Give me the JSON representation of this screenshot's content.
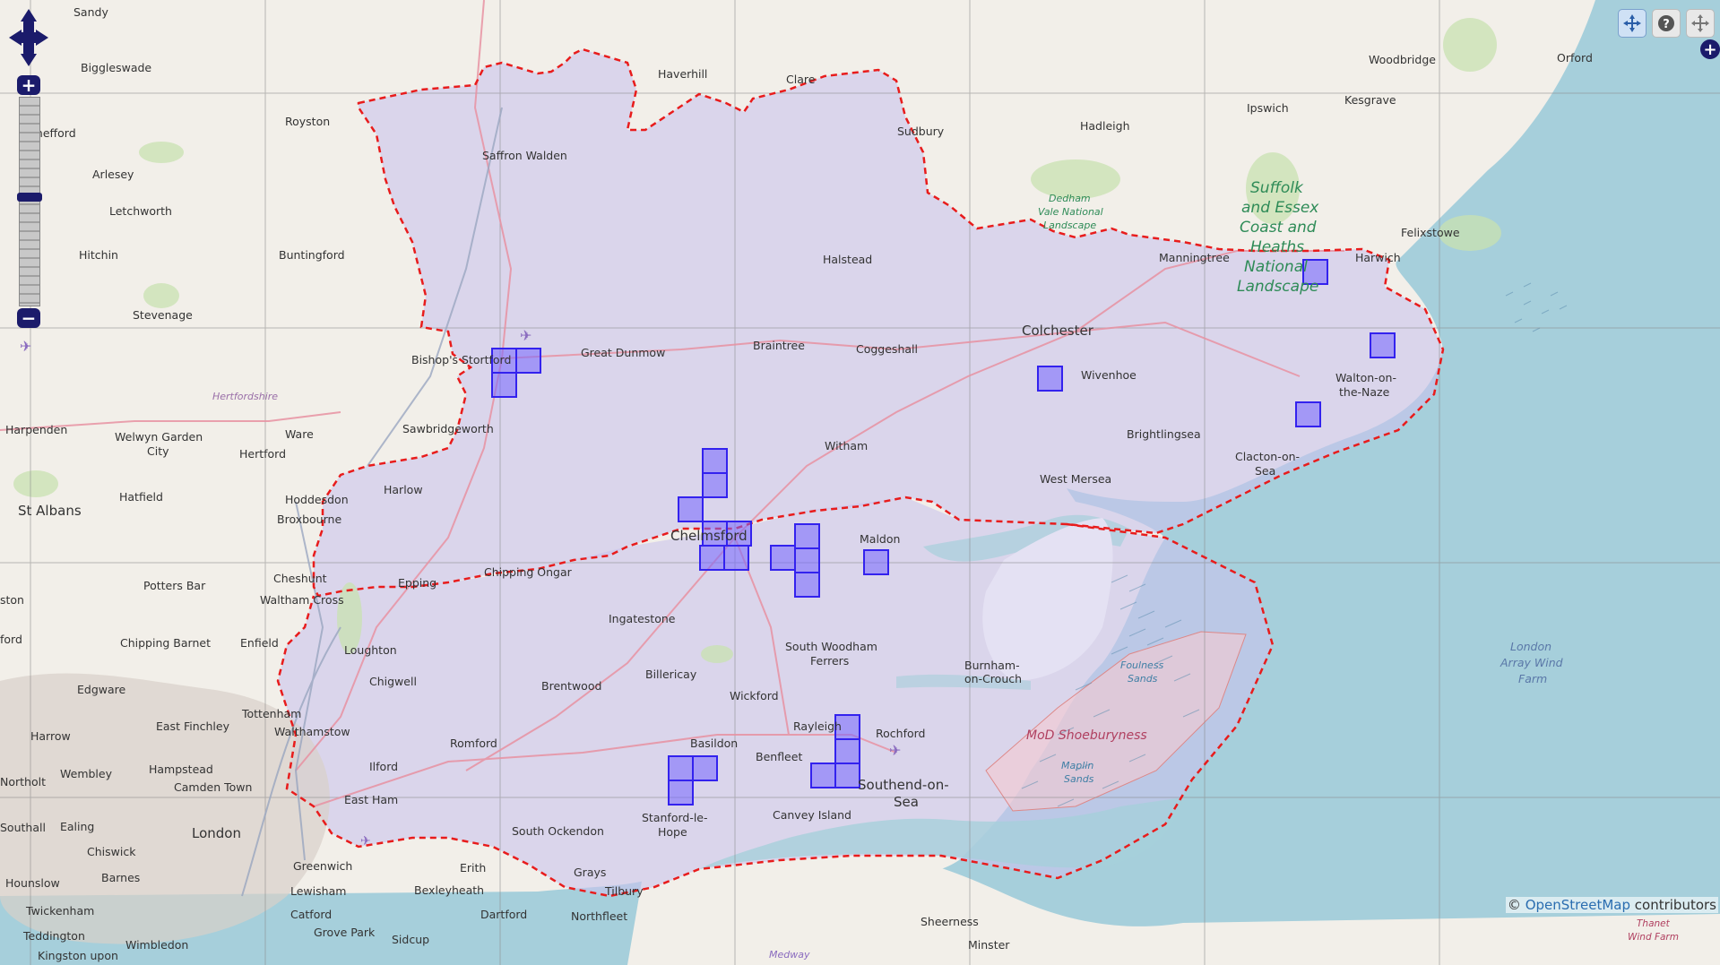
{
  "colors": {
    "sea": "#a6cfdb",
    "land": "#f2efe9",
    "region_fill": "#c9c3ec",
    "boundary": "#e81c1c",
    "square_stroke": "#3322ee",
    "square_fill": "#7766ff"
  },
  "map_labels": {
    "sandy": "Sandy",
    "biggleswade": "Biggleswade",
    "haverhill": "Haverhill",
    "clare": "Clare",
    "woodbridge": "Woodbridge",
    "orford": "Orford",
    "shefford": "Shefford",
    "royston": "Royston",
    "saffron_walden": "Saffron Walden",
    "sudbury": "Sudbury",
    "hadleigh": "Hadleigh",
    "ipswich": "Ipswich",
    "kesgrave": "Kesgrave",
    "arlesey": "Arlesey",
    "letchworth": "Letchworth",
    "hitchin": "Hitchin",
    "buntingford": "Buntingford",
    "halstead": "Halstead",
    "stevenage": "Stevenage",
    "dedham": "Dedham",
    "vale_national": "Vale National",
    "landscape_small": "Landscape",
    "suffolk1": "Suffolk",
    "suffolk2": "and Essex",
    "suffolk3": "Coast and",
    "suffolk4": "Heaths",
    "suffolk5": "National",
    "suffolk6": "Landscape",
    "felixstowe": "Felixstowe",
    "manningtree": "Manningtree",
    "harwich": "Harwich",
    "colchester": "Colchester",
    "bishops_stortford": "Bishop's Stortford",
    "great_dunmow": "Great Dunmow",
    "braintree": "Braintree",
    "coggeshall": "Coggeshall",
    "wivenhoe": "Wivenhoe",
    "walton1": "Walton-on-",
    "walton2": "the-Naze",
    "hertfordshire": "Hertfordshire",
    "harpenden": "Harpenden",
    "sawbridgeworth": "Sawbridgeworth",
    "ware": "Ware",
    "welwyn1": "Welwyn Garden",
    "welwyn2": "City",
    "hertford": "Hertford",
    "witham": "Witham",
    "brightlingsea": "Brightlingsea",
    "clacton1": "Clacton-on-",
    "clacton2": "Sea",
    "harlow": "Harlow",
    "west_mersea": "West Mersea",
    "st_albans": "St Albans",
    "hatfield": "Hatfield",
    "hoddesdon": "Hoddesdon",
    "broxbourne": "Broxbourne",
    "chelmsford": "Chelmsford",
    "maldon": "Maldon",
    "potters_bar": "Potters Bar",
    "cheshunt": "Cheshunt",
    "chipping_ongar": "Chipping Ongar",
    "epping": "Epping",
    "waltham_cross": "Waltham Cross",
    "ston": "ston",
    "ingatestone": "Ingatestone",
    "chipping_barnet": "Chipping Barnet",
    "enfield": "Enfield",
    "ford": "ford",
    "loughton": "Loughton",
    "south_woodham1": "South Woodham",
    "south_woodham2": "Ferrers",
    "billericay": "Billericay",
    "burnham1": "Burnham-",
    "burnham2": "on-Crouch",
    "chigwell": "Chigwell",
    "brentwood": "Brentwood",
    "wickford": "Wickford",
    "foulness1": "Foulness",
    "foulness2": "Sands",
    "london_array1": "London",
    "london_array2": "Array Wind",
    "london_array3": "Farm",
    "edgware": "Edgware",
    "tottenham": "Tottenham",
    "east_finchley": "East Finchley",
    "walthamstow": "Walthamstow",
    "rayleigh": "Rayleigh",
    "rochford": "Rochford",
    "harrow": "Harrow",
    "romford": "Romford",
    "basildon": "Basildon",
    "mod": "MoD Shoeburyness",
    "benfleet": "Benfleet",
    "ilford": "Ilford",
    "wembley": "Wembley",
    "hampstead": "Hampstead",
    "maplin1": "Maplin",
    "maplin2": "Sands",
    "northolt": "Northolt",
    "camden_town": "Camden Town",
    "east_ham": "East Ham",
    "southend1": "Southend-on-",
    "southend2": "Sea",
    "stanford1": "Stanford-le-",
    "stanford2": "Hope",
    "canvey": "Canvey Island",
    "southall": "Southall",
    "ealing": "Ealing",
    "london": "London",
    "south_ockendon": "South Ockendon",
    "chiswick": "Chiswick",
    "greenwich": "Greenwich",
    "erith": "Erith",
    "hounslow": "Hounslow",
    "barnes": "Barnes",
    "bexleyheath": "Bexleyheath",
    "grays": "Grays",
    "lewisham": "Lewisham",
    "tilbury": "Tilbury",
    "twickenham": "Twickenham",
    "catford": "Catford",
    "dartford": "Dartford",
    "northfleet": "Northfleet",
    "sheerness": "Sheerness",
    "teddington": "Teddington",
    "grove_park": "Grove Park",
    "sidcup": "Sidcup",
    "wimbledon": "Wimbledon",
    "minster": "Minster",
    "thanet1": "Thanet",
    "thanet2": "Wind Farm",
    "kingston": "Kingston upon",
    "medway": "Medway"
  },
  "controls": {
    "zoom_in": "+",
    "zoom_out": "−",
    "corner_plus": "+",
    "tools": [
      {
        "icon": "navigation-icon"
      },
      {
        "icon": "query-icon"
      },
      {
        "icon": "pan-icon"
      }
    ]
  },
  "attribution": {
    "prefix": "©",
    "link": "OpenStreetMap",
    "suffix": "contributors"
  }
}
